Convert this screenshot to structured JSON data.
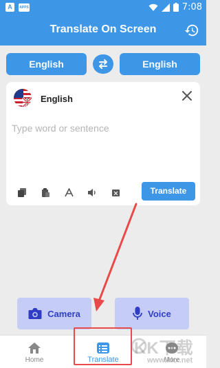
{
  "status_bar": {
    "badge_a": "A",
    "badge_b": "APPS",
    "time": "7:08"
  },
  "header": {
    "title": "Translate On Screen",
    "history_icon": "history-icon"
  },
  "languages": {
    "source": "English",
    "target": "English",
    "swap_icon": "swap-arrows-icon"
  },
  "input_card": {
    "language": "English",
    "flag": "us-uk-flag-icon",
    "placeholder": "Type word or sentence",
    "tools": [
      "copy-icon",
      "paste-icon",
      "font-icon",
      "speaker-icon",
      "delete-icon"
    ],
    "translate_label": "Translate"
  },
  "actions": {
    "camera_label": "Camera",
    "voice_label": "Voice"
  },
  "bottom_nav": {
    "items": [
      {
        "label": "Home",
        "icon": "home-icon"
      },
      {
        "label": "Translate",
        "icon": "translate-icon",
        "active": true
      },
      {
        "label": "More",
        "icon": "more-icon"
      }
    ]
  },
  "watermark": {
    "text": "KK下载",
    "url": "www.kkx.net"
  },
  "colors": {
    "primary": "#3d96e6",
    "action_bg": "#c5cdf6",
    "action_fg": "#2f3ec4",
    "highlight": "#e84a4a"
  }
}
